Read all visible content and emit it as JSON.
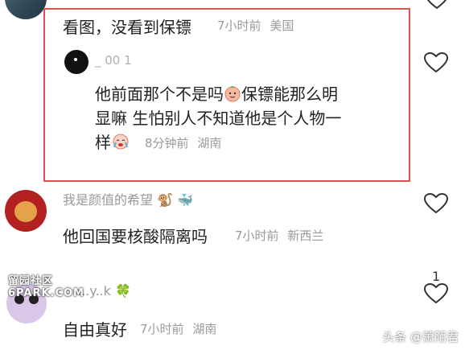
{
  "comments": [
    {
      "text": "看图，没看到保镖",
      "time": "7小时前",
      "location": "美国"
    },
    {
      "username": "_ 00 1",
      "text_line1": "他前面那个不是吗",
      "text_line1b": "保镖能那么明",
      "text_line2": "显嘛 生怕别人不知道他是个人物一",
      "text_line3": "样",
      "time": "8分钟前",
      "location": "湖南"
    },
    {
      "username": "我是颜值的希望",
      "text": "他回国要核酸隔离吗",
      "time": "7小时前",
      "location": "新西兰"
    },
    {
      "username": "...y..k",
      "text": "自由真好",
      "time": "7小时前",
      "location": "湖南",
      "like_count": "1"
    }
  ],
  "watermark": {
    "line1": "留园社区",
    "line2": "6PARK.COM"
  },
  "footer": "头条 @萧陌君",
  "colors": {
    "highlight": "#d9534f",
    "meta": "#9a9a9a"
  }
}
